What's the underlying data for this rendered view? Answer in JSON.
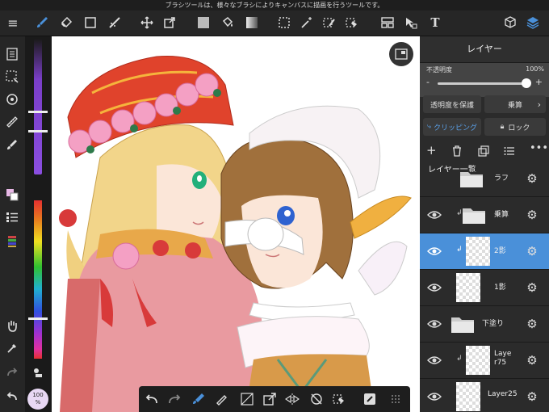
{
  "status_text": "ブラシツールは、様々なブラシによりキャンバスに描画を行うツールです。",
  "toolbar": {
    "menu_icon": "≡",
    "text_tool_label": "T"
  },
  "left_panel": {
    "zoom_value": "100",
    "zoom_unit": "%"
  },
  "layer_panel": {
    "title": "レイヤー",
    "opacity_label": "不透明度",
    "opacity_value": "100%",
    "opacity_minus": "-",
    "opacity_plus": "+",
    "opacity_fraction": 0.96,
    "protect_alpha_label": "透明度を保護",
    "blend_mode_label": "乗算",
    "clipping_label": "クリッピング",
    "lock_label": "ロック",
    "list_title": "レイヤー一覧",
    "layers": [
      {
        "name": "ラフ",
        "type": "folder",
        "visible": false,
        "clip": false,
        "selected": false
      },
      {
        "name": "乗算",
        "type": "folder",
        "visible": true,
        "clip": true,
        "selected": false
      },
      {
        "name": "2影",
        "type": "layer",
        "visible": true,
        "clip": true,
        "selected": true
      },
      {
        "name": "1影",
        "type": "layer",
        "visible": true,
        "clip": false,
        "selected": false
      },
      {
        "name": "下塗り",
        "type": "folder",
        "visible": true,
        "clip": false,
        "selected": false
      },
      {
        "name": "Laye\nr75",
        "type": "layer",
        "visible": true,
        "clip": true,
        "selected": false
      },
      {
        "name": "Layer25",
        "type": "layer",
        "visible": true,
        "clip": false,
        "selected": false
      }
    ]
  },
  "colors": {
    "accent": "#4a90d9",
    "brush_color": "#e8b8e6"
  }
}
